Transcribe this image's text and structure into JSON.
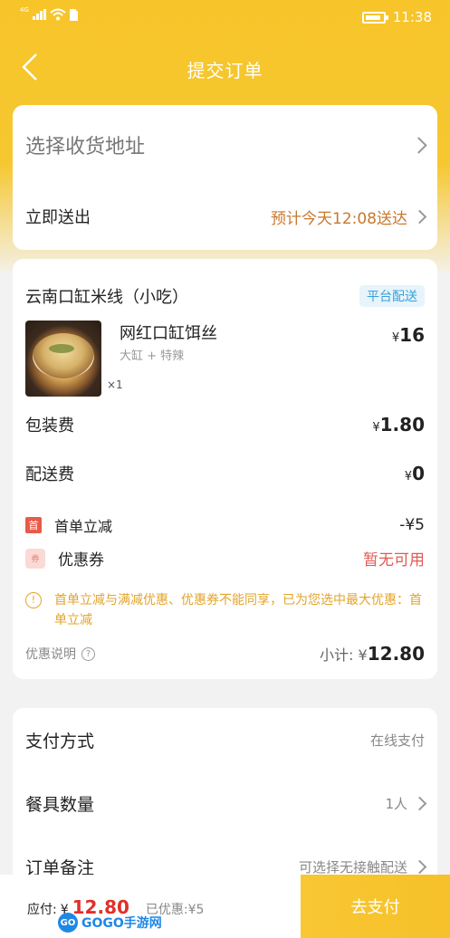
{
  "status_bar": {
    "network": "4G",
    "time": "11:38"
  },
  "nav": {
    "title": "提交订单"
  },
  "address": {
    "placeholder": "选择收货地址",
    "deliver_label": "立即送出",
    "eta": "预计今天12:08送达"
  },
  "order": {
    "shop_name": "云南口缸米线（小吃）",
    "platform_badge": "平台配送",
    "item": {
      "name": "网红口缸饵丝",
      "spec": "大缸 + 特辣",
      "qty": "×1",
      "currency": "¥",
      "price": "16"
    },
    "packaging": {
      "label": "包装费",
      "currency": "¥",
      "value": "1.80"
    },
    "delivery": {
      "label": "配送费",
      "currency": "¥",
      "value": "0"
    },
    "first_discount": {
      "tag": "首",
      "label": "首单立减",
      "value": "-¥5"
    },
    "coupon": {
      "tag": "券",
      "label": "优惠券",
      "value": "暂无可用"
    },
    "notice": "首单立减与满减优惠、优惠券不能同享，已为您选中最大优惠：首单立减",
    "discount_explain": "优惠说明",
    "subtotal_label": "小计:",
    "subtotal_currency": "¥",
    "subtotal_value": "12.80"
  },
  "payment": {
    "method_label": "支付方式",
    "method_value": "在线支付",
    "utensils_label": "餐具数量",
    "utensils_value": "1人",
    "remark_label": "订单备注",
    "remark_value": "可选择无接触配送"
  },
  "bottom": {
    "due_label": "应付:",
    "currency": "¥",
    "amount": "12.80",
    "saved": "已优惠:¥5",
    "pay_button": "去支付"
  },
  "watermark": {
    "logo": "GO",
    "text": "GOGO手游网"
  },
  "colors": {
    "brand": "#f7c52a",
    "accent": "#c8772c",
    "price_red": "#e0302a",
    "badge_blue": "#3aa0d8"
  }
}
